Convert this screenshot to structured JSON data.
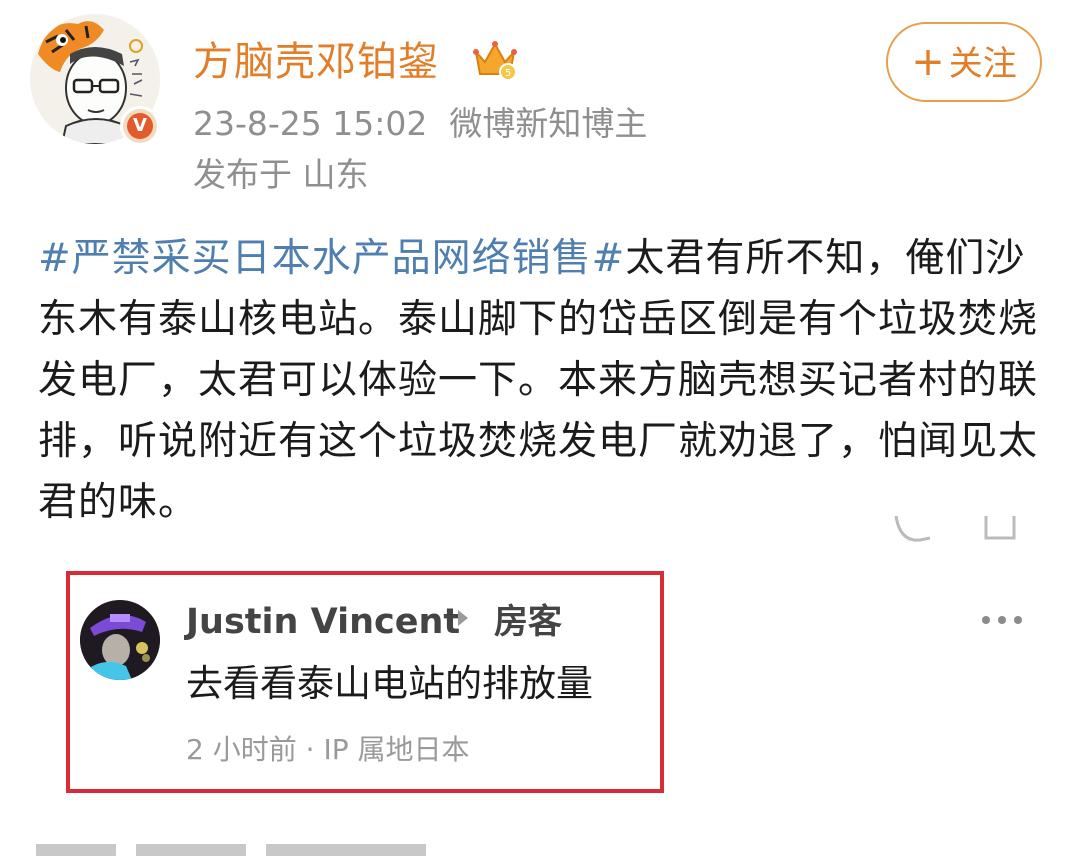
{
  "post": {
    "author": "方脑壳邓铂鋆",
    "timestamp": "23-8-25 15:02",
    "author_title": "微博新知博主",
    "location": "发布于 山东",
    "follow_button": "关注",
    "hashtag": "#严禁采买日本水产品网络销售#",
    "body": "太君有所不知，俺们沙东木有泰山核电站。泰山脚下的岱岳区倒是有个垃圾焚烧发电厂，太君可以体验一下。本来方脑壳想买记者村的联排，听说附近有这个垃圾焚烧发电厂就劝退了，怕闻见太君的味。",
    "verified_badge": "V"
  },
  "comment": {
    "username": "Justin Vincent",
    "badge": "房客",
    "text": "去看看泰山电站的排放量",
    "time": "2 小时前",
    "ip_location": "IP 属地日本"
  },
  "icons": [
    "tiger-avatar-icon",
    "verified-icon",
    "crown-level-icon",
    "more-icon",
    "commenter-avatar"
  ],
  "colors": {
    "accent": "#e27e2a",
    "hashtag": "#4f7fb0",
    "highlight_border": "#d92b35"
  }
}
